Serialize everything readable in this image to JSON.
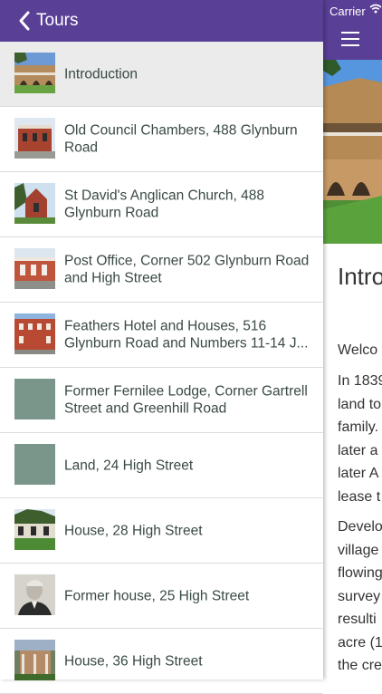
{
  "status": {
    "carrier": "Carrier"
  },
  "sidebar": {
    "back_label": "Tours",
    "items": [
      {
        "title": "Introduction",
        "thumb": "building-photo",
        "active": true
      },
      {
        "title": "Old Council Chambers, 488 Glynburn Road",
        "thumb": "brick-building-photo"
      },
      {
        "title": "St David's Anglican Church, 488 Glynburn Road",
        "thumb": "church-photo"
      },
      {
        "title": "Post Office, Corner 502 Glynburn Road and High Street",
        "thumb": "post-office-photo"
      },
      {
        "title": "Feathers Hotel and Houses, 516 Glynburn Road and Numbers 11-14 J...",
        "thumb": "hotel-photo"
      },
      {
        "title": "Former Fernilee Lodge, Corner Gartrell Street and Greenhill Road",
        "thumb": "placeholder-gray"
      },
      {
        "title": "Land, 24 High Street",
        "thumb": "placeholder-gray"
      },
      {
        "title": "House, 28 High Street",
        "thumb": "house-photo"
      },
      {
        "title": "Former house, 25 High Street",
        "thumb": "portrait-photo"
      },
      {
        "title": "House, 36 High Street",
        "thumb": "house-veranda-photo"
      }
    ]
  },
  "content": {
    "title": "Intro",
    "paragraph1": [
      "Welco"
    ],
    "paragraph2": [
      "In 1839",
      "land to",
      "family.",
      "later a",
      "later A",
      "lease t"
    ],
    "paragraph3": [
      "Develo",
      "village",
      "flowing",
      "survey",
      "resulti",
      "acre (1",
      "the cre"
    ]
  },
  "colors": {
    "accent": "#5a3f96",
    "placeholder": "#7a958a",
    "active_row": "#eaebea"
  }
}
